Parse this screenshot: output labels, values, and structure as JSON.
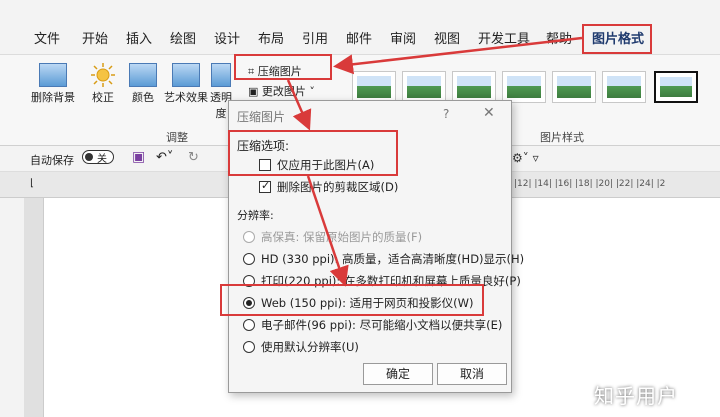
{
  "menu": {
    "tabs": [
      "文件",
      "开始",
      "插入",
      "绘图",
      "设计",
      "布局",
      "引用",
      "邮件",
      "审阅",
      "视图",
      "开发工具",
      "帮助",
      "图片格式"
    ],
    "active_tab": "图片格式"
  },
  "ribbon": {
    "remove_bg": "删除背景",
    "corrections": "校正",
    "color": "颜色",
    "artistic": "艺术效果",
    "transparency": "透明度",
    "compress": "压缩图片",
    "change": "更改图片",
    "group_adjust": "调整",
    "group_styles": "图片样式"
  },
  "qat": {
    "autosave": "自动保存",
    "toggle_state": "关",
    "ruler_numbers": "|12| |14| |16| |18| |20| |22| |24| |2"
  },
  "dialog": {
    "title": "压缩图片",
    "help": "?",
    "close": "✕",
    "compress_options_header": "压缩选项:",
    "only_this_picture": "仅应用于此图片(A)",
    "delete_cropped": "删除图片的剪裁区域(D)",
    "resolution_header": "分辨率:",
    "hifi": "高保真: 保留原始图片的质量(F)",
    "hd": "HD (330 ppi): 高质量，适合高清晰度(HD)显示(H)",
    "print": "打印(220 ppi): 在多数打印机和屏幕上质量良好(P)",
    "web": "Web (150 ppi): 适用于网页和投影仪(W)",
    "email": "电子邮件(96 ppi): 尽可能缩小文档以便共享(E)",
    "default_res": "使用默认分辨率(U)",
    "ok": "确定",
    "cancel": "取消",
    "only_this_checked": false,
    "delete_cropped_checked": true,
    "selected_resolution": "web"
  },
  "watermark": "知乎用户",
  "colors": {
    "annotation": "#d93a3a",
    "accent": "#1f3a6e"
  }
}
